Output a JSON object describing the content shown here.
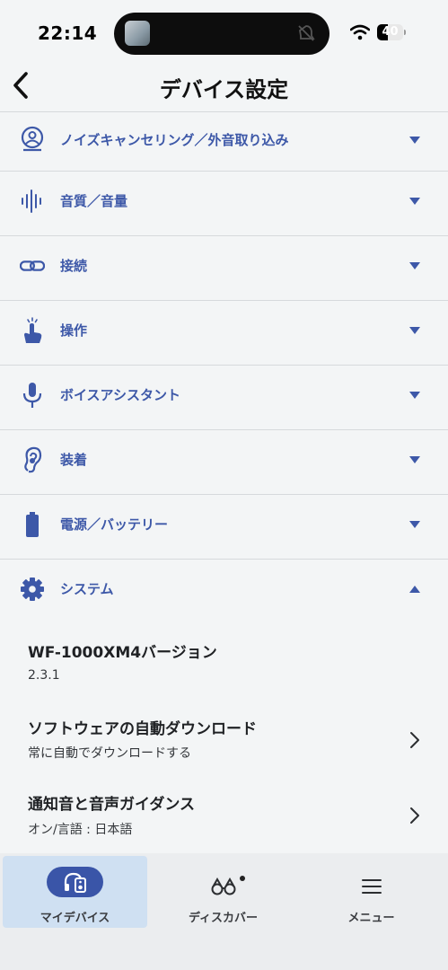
{
  "status_bar": {
    "time": "22:14",
    "battery": "40",
    "battery_level": 0.4
  },
  "header": {
    "back_icon": "chevron-left-icon",
    "title": "デバイス設定"
  },
  "sections": [
    {
      "label": "ノイズキャンセリング／外音取り込み",
      "icon": "ambient-sound-icon",
      "state": "collapsed"
    },
    {
      "label": "音質／音量",
      "icon": "sound-wave-icon",
      "state": "collapsed"
    },
    {
      "label": "接続",
      "icon": "link-icon",
      "state": "collapsed"
    },
    {
      "label": "操作",
      "icon": "touch-icon",
      "state": "collapsed"
    },
    {
      "label": "ボイスアシスタント",
      "icon": "microphone-icon",
      "state": "collapsed"
    },
    {
      "label": "装着",
      "icon": "ear-icon",
      "state": "collapsed"
    },
    {
      "label": "電源／バッテリー",
      "icon": "battery-icon",
      "state": "collapsed"
    },
    {
      "label": "システム",
      "icon": "gear-icon",
      "state": "expanded"
    }
  ],
  "system": {
    "version_title": "WF-1000XM4バージョン",
    "version_value": "2.3.1",
    "auto_download_title": "ソフトウェアの自動ダウンロード",
    "auto_download_value": "常に自動でダウンロードする",
    "notification_title": "通知音と音声ガイダンス",
    "notification_value": "オン/言語 : 日本語"
  },
  "bottom_nav": {
    "items": [
      {
        "label": "マイデバイス",
        "icon": "headphones-device-icon",
        "active": true
      },
      {
        "label": "ディスカバー",
        "icon": "binoculars-icon",
        "active": false,
        "badge": true
      },
      {
        "label": "メニュー",
        "icon": "hamburger-menu-icon",
        "active": false
      }
    ]
  },
  "colors": {
    "accent": "#3d58a8",
    "background": "#f3f5f6",
    "active_nav_bg": "#cfe0f2"
  }
}
